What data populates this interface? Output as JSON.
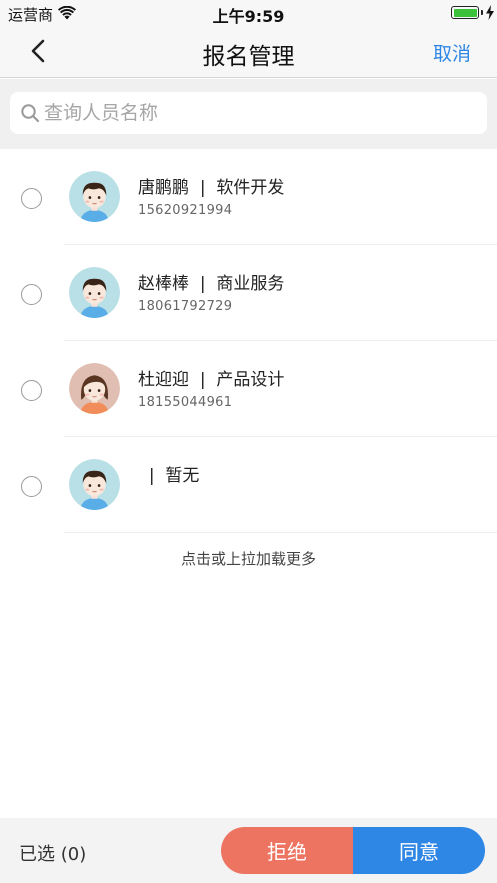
{
  "status_bar": {
    "carrier": "运营商",
    "time": "上午9:59",
    "wifi_icon": "wifi-icon",
    "battery_icon": "battery-icon",
    "charging_icon": "bolt-icon"
  },
  "nav": {
    "title": "报名管理",
    "cancel": "取消",
    "back_icon": "chevron-left-icon"
  },
  "search": {
    "placeholder": "查询人员名称",
    "value": "",
    "icon": "search-icon"
  },
  "applicants": [
    {
      "name": "唐鹏鹏",
      "separator": "|",
      "department": "软件开发",
      "phone": "15620921994",
      "avatar": "male-avatar"
    },
    {
      "name": "赵棒棒",
      "separator": "|",
      "department": "商业服务",
      "phone": "18061792729",
      "avatar": "male-avatar"
    },
    {
      "name": "杜迎迎",
      "separator": "|",
      "department": "产品设计",
      "phone": "18155044961",
      "avatar": "female-avatar"
    },
    {
      "name": "",
      "separator": "|",
      "department": "暂无",
      "phone": "",
      "avatar": "male-avatar"
    }
  ],
  "load_more": "点击或上拉加载更多",
  "footer": {
    "selected_label": "已选",
    "selected_count": "(0)",
    "reject": "拒绝",
    "agree": "同意"
  },
  "colors": {
    "accent_blue": "#2f87e5",
    "reject_red": "#ee7462",
    "battery_green": "#3cc13b"
  }
}
